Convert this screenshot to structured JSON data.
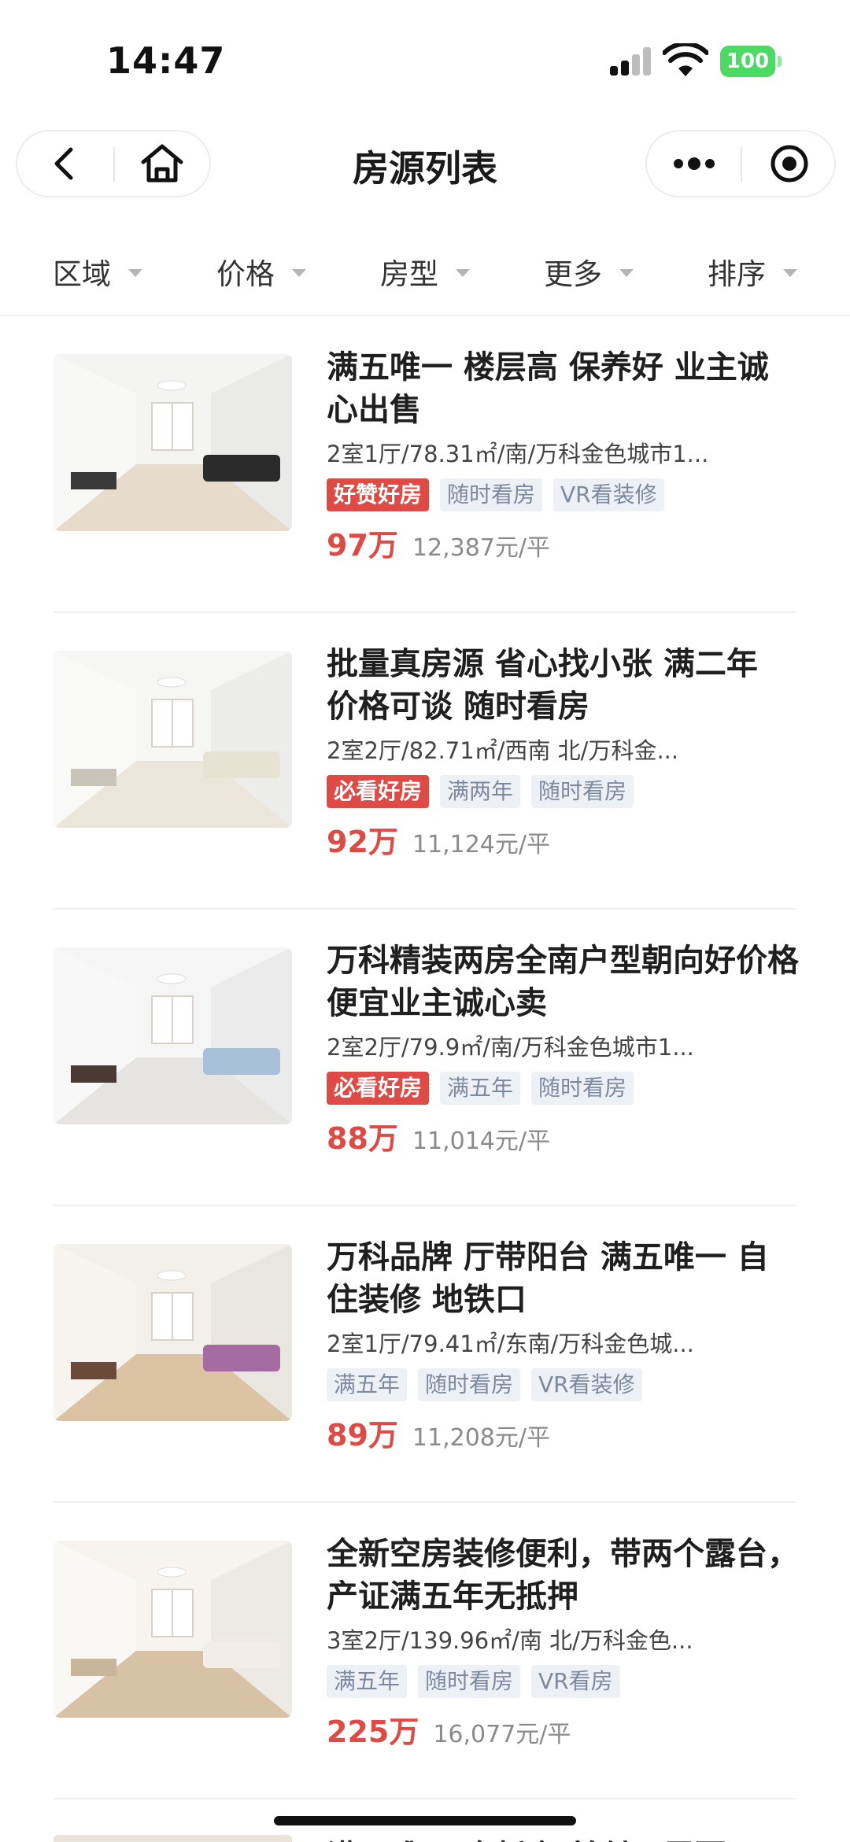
{
  "status_bar": {
    "time": "14:47",
    "battery": "100"
  },
  "nav": {
    "title": "房源列表"
  },
  "filters": [
    {
      "label": "区域"
    },
    {
      "label": "价格"
    },
    {
      "label": "房型"
    },
    {
      "label": "更多"
    },
    {
      "label": "排序"
    }
  ],
  "listings": [
    {
      "title": "满五唯一 楼层高 保养好 业主诚心出售",
      "meta": "2室1厅/78.31㎡/南/万科金色城市1...",
      "tags": [
        {
          "label": "好赞好房",
          "hot": true
        },
        {
          "label": "随时看房",
          "hot": false
        },
        {
          "label": "VR看装修",
          "hot": false
        }
      ],
      "price": "97万",
      "unit_price": "12,387元/平",
      "photo": {
        "wall": "#f4f4f2",
        "floor": "#e7dccb",
        "sofa": "#2b2b2b",
        "accent": "#3a3a3a"
      }
    },
    {
      "title": "批量真房源 省心找小张 满二年 价格可谈 随时看房",
      "meta": "2室2厅/82.71㎡/西南 北/万科金...",
      "tags": [
        {
          "label": "必看好房",
          "hot": true
        },
        {
          "label": "满两年",
          "hot": false
        },
        {
          "label": "随时看房",
          "hot": false
        }
      ],
      "price": "92万",
      "unit_price": "11,124元/平",
      "photo": {
        "wall": "#f6f6f4",
        "floor": "#ece6da",
        "sofa": "#e8e2d2",
        "accent": "#c9c4b8"
      }
    },
    {
      "title": "万科精装两房全南户型朝向好价格便宜业主诚心卖",
      "meta": "2室2厅/79.9㎡/南/万科金色城市1...",
      "tags": [
        {
          "label": "必看好房",
          "hot": true
        },
        {
          "label": "满五年",
          "hot": false
        },
        {
          "label": "随时看房",
          "hot": false
        }
      ],
      "price": "88万",
      "unit_price": "11,014元/平",
      "photo": {
        "wall": "#f5f5f5",
        "floor": "#e6e4e0",
        "sofa": "#a9c0d9",
        "accent": "#4a3a33"
      }
    },
    {
      "title": "万科品牌 厅带阳台 满五唯一 自住装修 地铁口",
      "meta": "2室1厅/79.41㎡/东南/万科金色城...",
      "tags": [
        {
          "label": "满五年",
          "hot": false
        },
        {
          "label": "随时看房",
          "hot": false
        },
        {
          "label": "VR看装修",
          "hot": false
        }
      ],
      "price": "89万",
      "unit_price": "11,208元/平",
      "photo": {
        "wall": "#f3efe9",
        "floor": "#dcc3a3",
        "sofa": "#a56aa2",
        "accent": "#6b4a3a"
      }
    },
    {
      "title": "全新空房装修便利，带两个露台，产证满五年无抵押",
      "meta": "3室2厅/139.96㎡/南 北/万科金色...",
      "tags": [
        {
          "label": "满五年",
          "hot": false
        },
        {
          "label": "随时看房",
          "hot": false
        },
        {
          "label": "VR看房",
          "hot": false
        }
      ],
      "price": "225万",
      "unit_price": "16,077元/平",
      "photo": {
        "wall": "#f7f4ef",
        "floor": "#d8c2a6",
        "sofa": "#f2ede6",
        "accent": "#c9b59a"
      }
    }
  ],
  "partial": {
    "title": "满五唯一 全新房 首付只需要"
  },
  "colors": {
    "accent": "#e04a44",
    "tag_bg": "#edf1f6",
    "tag_text": "#7c8aa0"
  }
}
